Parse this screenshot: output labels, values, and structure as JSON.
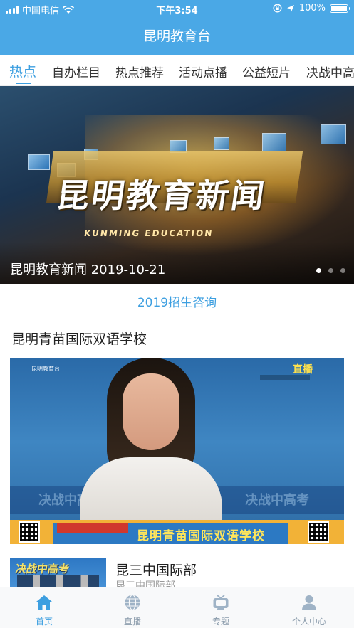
{
  "status_bar": {
    "carrier": "中国电信",
    "time": "下午3:54",
    "battery": "100%"
  },
  "nav": {
    "title": "昆明教育台"
  },
  "tabs": [
    {
      "label": "热点",
      "active": true
    },
    {
      "label": "自办栏目",
      "active": false
    },
    {
      "label": "热点推荐",
      "active": false
    },
    {
      "label": "活动点播",
      "active": false
    },
    {
      "label": "公益短片",
      "active": false
    },
    {
      "label": "决战中高",
      "active": false
    }
  ],
  "banner": {
    "title": "昆明教育新闻",
    "subtitle": "KUNMING EDUCATION",
    "caption": "昆明教育新闻 2019-10-21",
    "slide_count": 3,
    "active_slide": 1
  },
  "section": {
    "title": "2019招生咨询"
  },
  "feature": {
    "title": "昆明青苗国际双语学校",
    "live_label": "直播",
    "lower_third": "昆明青苗国际双语学校",
    "watermark": "决战中高考"
  },
  "list": [
    {
      "title": "昆三中国际部",
      "subtitle": "昆三中国际部",
      "thumb_text": "决战中高考"
    }
  ],
  "tabbar": [
    {
      "label": "首页",
      "icon": "home-icon",
      "active": true
    },
    {
      "label": "直播",
      "icon": "globe-icon",
      "active": false
    },
    {
      "label": "专题",
      "icon": "tv-icon",
      "active": false
    },
    {
      "label": "个人中心",
      "icon": "user-icon",
      "active": false
    }
  ],
  "colors": {
    "accent": "#3d9fe0",
    "header": "#4aa8e6",
    "inactive_tab": "#8a9bab"
  }
}
